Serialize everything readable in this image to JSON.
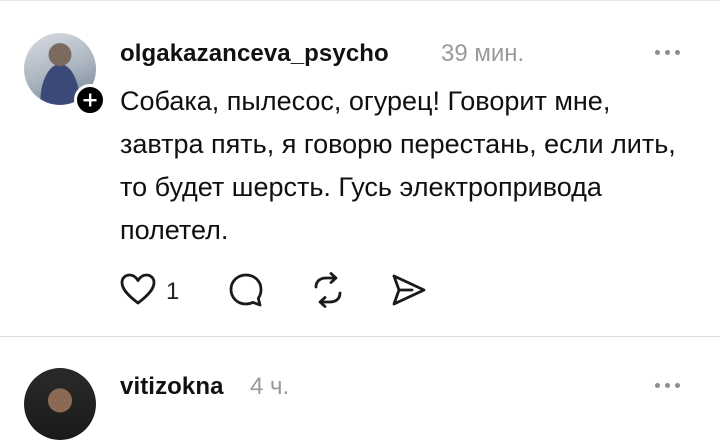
{
  "posts": [
    {
      "username": "olgakazanceva_psycho",
      "time": "39 мин.",
      "text": "Собака, пылесос, огурец! Говорит мне, завтра пять, я говорю перестань, если лить, то будет шерсть. Гусь электропривода полетел.",
      "likes": "1"
    },
    {
      "username": "vitizokna",
      "time": "4 ч."
    }
  ],
  "icons": {
    "follow_badge": "plus-icon",
    "more": "more-dots-icon",
    "like": "heart-icon",
    "comment": "comment-bubble-icon",
    "repost": "repost-icon",
    "share": "send-icon"
  }
}
